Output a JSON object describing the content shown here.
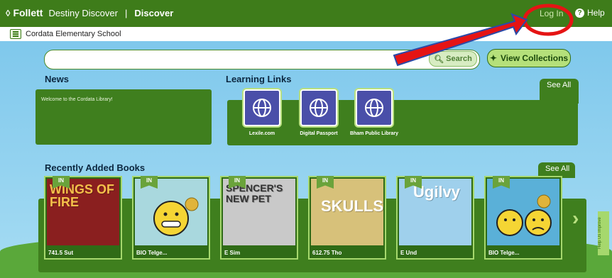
{
  "header": {
    "brand_logo": "Follett",
    "product": "Destiny Discover",
    "separator": "|",
    "section": "Discover",
    "login_label": "Log In",
    "help_label": "Help"
  },
  "school": {
    "name": "Cordata Elementary School"
  },
  "search": {
    "value": "",
    "button_label": "Search"
  },
  "view_collections_label": "View Collections",
  "news": {
    "heading": "News",
    "message": "Welcome to the Cordata Library!"
  },
  "learning_links": {
    "heading": "Learning Links",
    "see_all": "See All",
    "items": [
      {
        "label": "Lexile.com",
        "icon": "globe-icon"
      },
      {
        "label": "Digital Passport",
        "icon": "globe-icon"
      },
      {
        "label": "Bham Public Library",
        "icon": "globe-icon"
      }
    ]
  },
  "recent_books": {
    "heading": "Recently Added Books",
    "see_all": "See All",
    "items": [
      {
        "status": "IN",
        "call": "741.5 Sut",
        "title": "WINGS OF FIRE",
        "color": "#8a1f1f"
      },
      {
        "status": "IN",
        "call": "BIO Telge...",
        "title": "",
        "color": "#a9d8de"
      },
      {
        "status": "IN",
        "call": "E Sim",
        "title": "SPENCER'S NEW PET",
        "color": "#c9c9c9"
      },
      {
        "status": "IN",
        "call": "612.75 Tho",
        "title": "SKULLS!",
        "color": "#d7c17a"
      },
      {
        "status": "IN",
        "call": "E Und",
        "title": "Ugilvy",
        "color": "#9fd0ec"
      },
      {
        "status": "IN",
        "call": "BIO Telge...",
        "title": "",
        "color": "#5ab0d8"
      }
    ]
  },
  "side_tab": "Help Us Improve"
}
